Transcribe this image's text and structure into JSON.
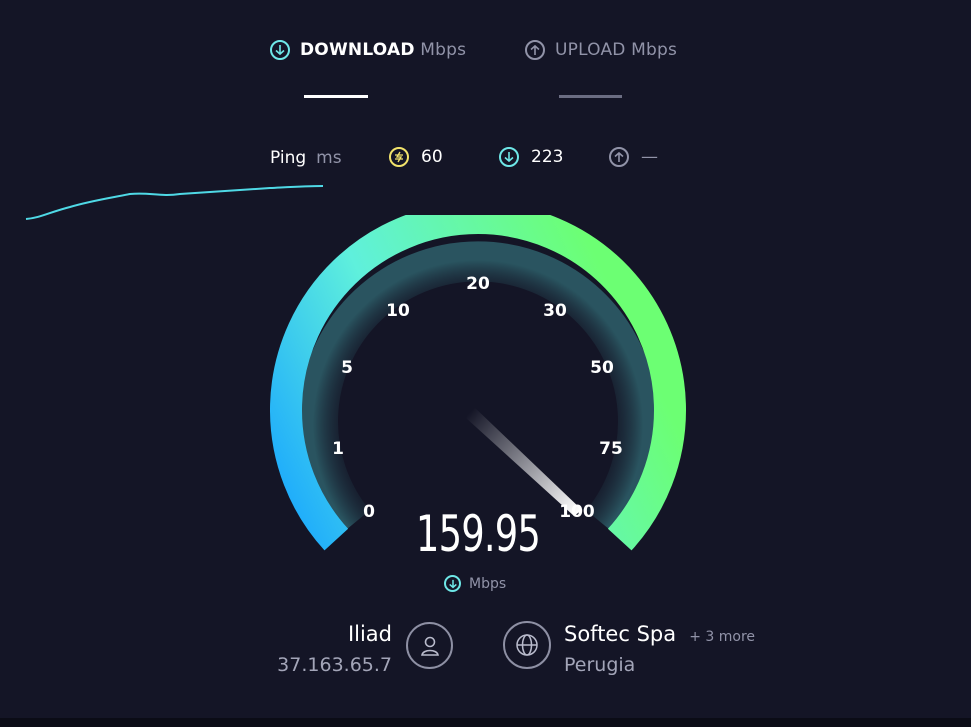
{
  "tabs": {
    "download": {
      "label": "DOWNLOAD",
      "unit": "Mbps",
      "icon": "download-arrow-icon"
    },
    "upload": {
      "label": "UPLOAD",
      "unit": "Mbps",
      "icon": "upload-arrow-icon"
    }
  },
  "ping": {
    "label": "Ping",
    "unit": "ms",
    "idle": {
      "value": "60",
      "icon": "ping-bolt-icon",
      "color": "#f2e36b"
    },
    "download": {
      "value": "223",
      "icon": "download-arrow-icon",
      "color": "#6ee7e7"
    },
    "upload": {
      "value": "—",
      "icon": "upload-arrow-icon",
      "color": "#9193a8"
    }
  },
  "gauge": {
    "ticks": [
      "0",
      "1",
      "5",
      "10",
      "20",
      "30",
      "50",
      "75",
      "100"
    ],
    "needle_tick_position": 8,
    "value": "159.95",
    "unit": "Mbps",
    "unit_icon": "download-arrow-icon"
  },
  "provider": {
    "name": "Iliad",
    "ip": "37.163.65.7",
    "icon": "user-icon"
  },
  "server": {
    "name": "Softec Spa",
    "more": "+ 3 more",
    "location": "Perugia",
    "icon": "globe-icon"
  },
  "colors": {
    "background": "#141526",
    "gauge_start": "#1aa7ff",
    "gauge_mid": "#5af0e0",
    "gauge_end": "#6bff7a",
    "graph_line": "#4fd9e6"
  }
}
